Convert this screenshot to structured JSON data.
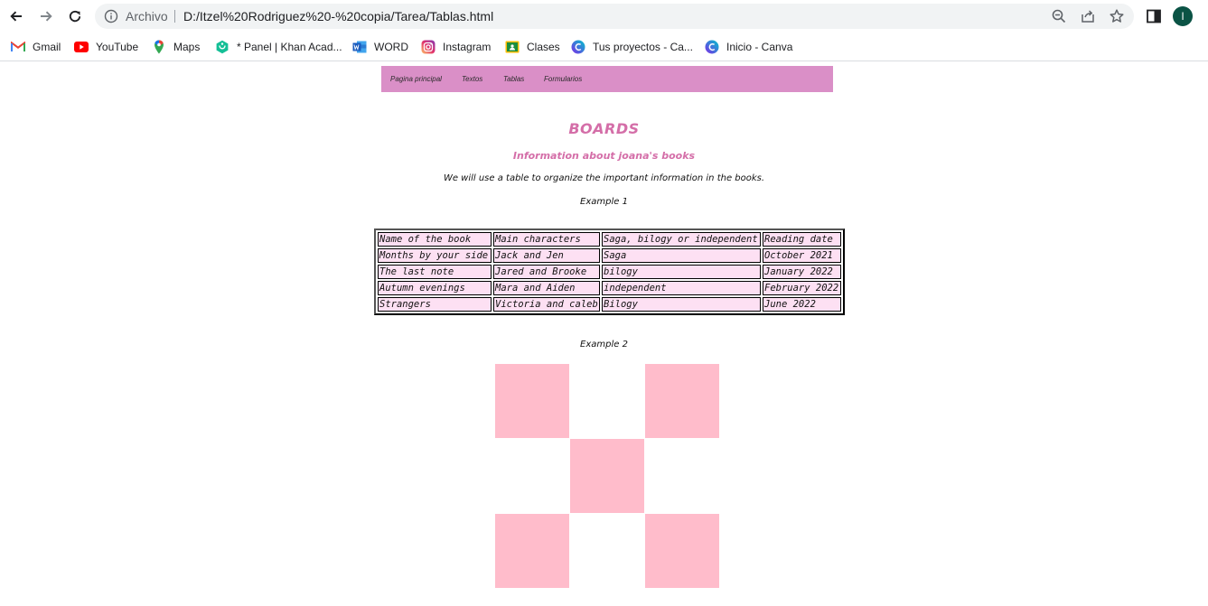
{
  "browser": {
    "omnibox": {
      "security_label": "Archivo",
      "url": "D:/Itzel%20Rodriguez%20-%20copia/Tarea/Tablas.html"
    },
    "profile_initial": "I",
    "accent_color": "#0b5345"
  },
  "bookmarks": [
    {
      "label": "Gmail",
      "icon": "gmail-icon"
    },
    {
      "label": "YouTube",
      "icon": "youtube-icon"
    },
    {
      "label": "Maps",
      "icon": "maps-icon"
    },
    {
      "label": "* Panel | Khan Acad...",
      "icon": "khan-academy-icon"
    },
    {
      "label": "WORD",
      "icon": "word-icon"
    },
    {
      "label": "Instagram",
      "icon": "instagram-icon"
    },
    {
      "label": "Clases",
      "icon": "classroom-icon"
    },
    {
      "label": "Tus proyectos - Ca...",
      "icon": "canva-icon"
    },
    {
      "label": "Inicio - Canva",
      "icon": "canva-icon"
    }
  ],
  "site_nav": {
    "items": [
      "Pagina principal",
      "Textos",
      "Tablas",
      "Formularios"
    ],
    "background": "#da8fc7"
  },
  "content": {
    "title": "BOARDS",
    "subtitle": "Information about joana's books",
    "intro": "We will use a table to organize the important information in the books.",
    "example1_label": "Example 1",
    "example2_label": "Example 2",
    "heading_color": "#d46ea8"
  },
  "books_table": {
    "headers": [
      "Name of the book",
      "Main characters",
      "Saga, bilogy or independent",
      "Reading date"
    ],
    "rows": [
      [
        "Months by your side",
        "Jack and Jen",
        "Saga",
        "October 2021"
      ],
      [
        "The last note",
        "Jared and Brooke",
        "bilogy",
        "January 2022"
      ],
      [
        "Autumn evenings",
        "Mara and Aiden",
        "independent",
        "February 2022"
      ],
      [
        "Strangers",
        "Victoria and caleb",
        "Bilogy",
        "June 2022"
      ]
    ],
    "cell_color": "#fde0f3"
  },
  "checker_grid": {
    "pattern": [
      [
        1,
        0,
        1
      ],
      [
        0,
        1,
        0
      ],
      [
        1,
        0,
        1
      ]
    ],
    "pink_color": "#ffbccb"
  }
}
